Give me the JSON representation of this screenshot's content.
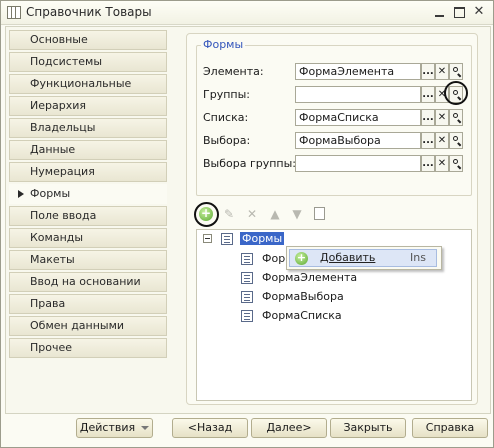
{
  "window": {
    "title": "Справочник Товары"
  },
  "nav": {
    "items": [
      "Основные",
      "Подсистемы",
      "Функциональные опции",
      "Иерархия",
      "Владельцы",
      "Данные",
      "Нумерация",
      "Формы",
      "Поле ввода",
      "Команды",
      "Макеты",
      "Ввод на основании",
      "Права",
      "Обмен данными",
      "Прочее"
    ],
    "active": "Формы"
  },
  "forms_group": {
    "legend": "Формы",
    "rows": [
      {
        "label": "Элемента:",
        "value": "ФормаЭлемента"
      },
      {
        "label": "Группы:",
        "value": ""
      },
      {
        "label": "Списка:",
        "value": "ФормаСписка"
      },
      {
        "label": "Выбора:",
        "value": "ФормаВыбора"
      },
      {
        "label": "Выбора группы:",
        "value": ""
      }
    ],
    "button_glyphs": {
      "select": "...",
      "clear": "✕"
    }
  },
  "toolbar": {
    "add": "+",
    "edit": "✎",
    "delete": "✕",
    "up": "▲",
    "down": "▼"
  },
  "tree": {
    "root": "Формы",
    "children": [
      "Форм",
      "ФормаЭлемента",
      "ФормаВыбора",
      "ФормаСписка"
    ]
  },
  "context_menu": {
    "glyph": "+",
    "label": "Добавить",
    "shortcut": "Ins"
  },
  "buttons": {
    "actions": "Действия",
    "back": "<Назад",
    "next": "Далее>",
    "close": "Закрыть",
    "help": "Справка"
  }
}
